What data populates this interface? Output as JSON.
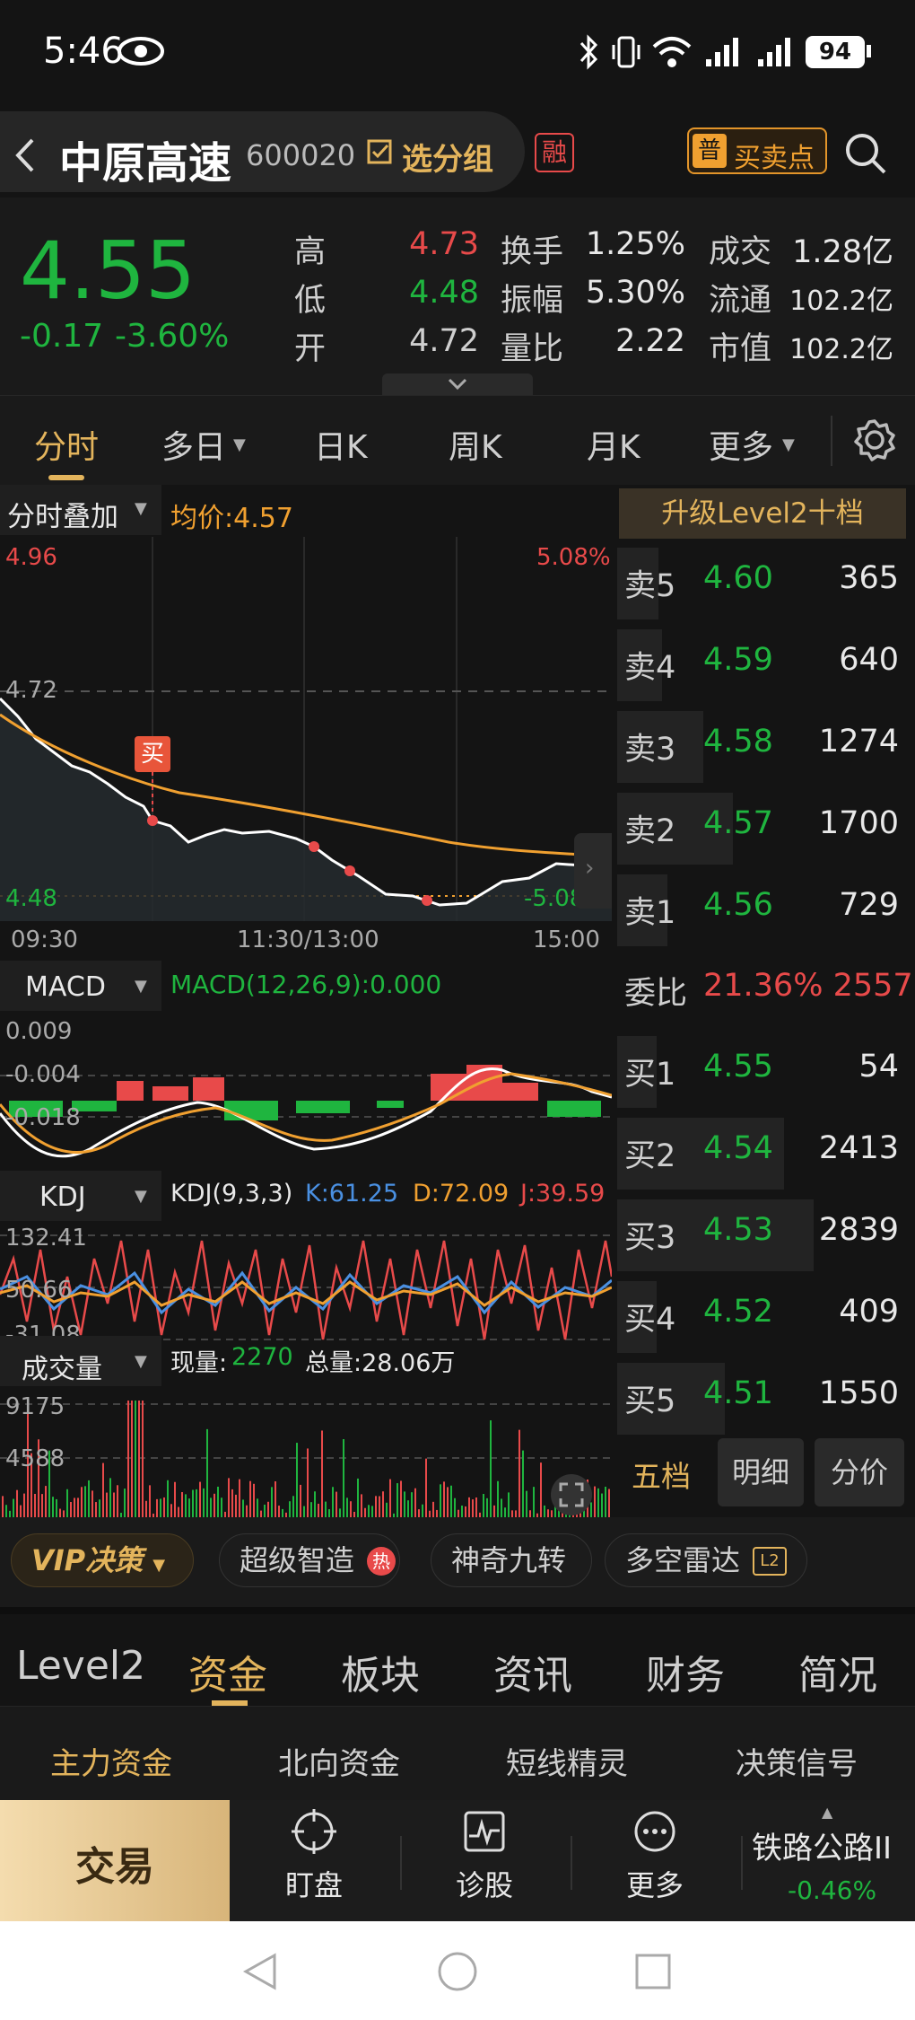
{
  "status": {
    "time": "5:46",
    "battery": "94"
  },
  "nav": {
    "name": "中原高速",
    "code": "600020",
    "group_btn": "选分组",
    "rong": "融",
    "pu": "普",
    "buy_sell": "买卖点"
  },
  "quote": {
    "price": "4.55",
    "change": "-0.17",
    "change_pct": "-3.60%",
    "high_label": "高",
    "high": "4.73",
    "low_label": "低",
    "low": "4.48",
    "open_label": "开",
    "open": "4.72",
    "turnover_label": "换手",
    "turnover": "1.25%",
    "amplitude_label": "振幅",
    "amplitude": "5.30%",
    "vratio_label": "量比",
    "vratio": "2.22",
    "amount_label": "成交",
    "amount": "1.28亿",
    "float_label": "流通",
    "float_cap": "102.2亿",
    "mcap_label": "市值",
    "mcap": "102.2亿"
  },
  "tabs": [
    "分时",
    "多日",
    "日K",
    "周K",
    "月K",
    "更多"
  ],
  "intraday": {
    "overlay": "分时叠加",
    "avg": "均价:4.57",
    "top_price": "4.96",
    "top_pct": "5.08%",
    "ref_price": "4.72",
    "bottom_price": "4.48",
    "bottom_pct": "-5.08%",
    "buy_tag": "买",
    "t_start": "09:30",
    "t_mid": "11:30/13:00",
    "t_end": "15:00"
  },
  "macd": {
    "label": "MACD",
    "param": "MACD(12,26,9):0.000",
    "t1": "0.009",
    "t2": "-0.004",
    "t3": "-0.018"
  },
  "kdj": {
    "label": "KDJ",
    "param": "KDJ(9,3,3)",
    "k": "K:61.25",
    "d": "D:72.09",
    "j": "J:39.59",
    "t1": "132.41",
    "t2": "50.66",
    "t3": "-31.08"
  },
  "volume": {
    "label": "成交量",
    "now_label": "现量:",
    "now": "2270",
    "total": "总量:28.06万",
    "t1": "9175",
    "t2": "4588"
  },
  "orderbook": {
    "upgrade": "升级Level2十档",
    "sells": [
      {
        "l": "卖5",
        "p": "4.60",
        "v": "365",
        "w": 0.14
      },
      {
        "l": "卖4",
        "p": "4.59",
        "v": "640",
        "w": 0.15
      },
      {
        "l": "卖3",
        "p": "4.58",
        "v": "1274",
        "w": 0.29
      },
      {
        "l": "卖2",
        "p": "4.57",
        "v": "1700",
        "w": 0.39
      },
      {
        "l": "卖1",
        "p": "4.56",
        "v": "729",
        "w": 0.17
      }
    ],
    "ratio_label": "委比",
    "ratio": "21.36% 2557",
    "buys": [
      {
        "l": "买1",
        "p": "4.55",
        "v": "54",
        "w": 0.02
      },
      {
        "l": "买2",
        "p": "4.54",
        "v": "2413",
        "w": 0.56
      },
      {
        "l": "买3",
        "p": "4.53",
        "v": "2839",
        "w": 0.66
      },
      {
        "l": "买4",
        "p": "4.52",
        "v": "409",
        "w": 0.1
      },
      {
        "l": "买5",
        "p": "4.51",
        "v": "1550",
        "w": 0.36
      }
    ],
    "tabs": [
      "五档",
      "明细",
      "分价"
    ]
  },
  "features": {
    "vip": "VIP决策",
    "f1": "超级智造",
    "hot": "热",
    "f2": "神奇九转",
    "f3": "多空雷达",
    "l2": "L2"
  },
  "bottom_tabs": [
    "Level2",
    "资金",
    "板块",
    "资讯",
    "财务",
    "简况"
  ],
  "sub_tabs": [
    "主力资金",
    "北向资金",
    "短线精灵",
    "决策信号"
  ],
  "trade": {
    "main": "交易",
    "b1": "盯盘",
    "b2": "诊股",
    "b3": "更多",
    "sector": "铁路公路II",
    "sector_chg": "-0.46%"
  },
  "colors": {
    "up": "#e84a4a",
    "down": "#1fb53f",
    "avg": "#f0a030",
    "gold": "#e3b45c"
  }
}
